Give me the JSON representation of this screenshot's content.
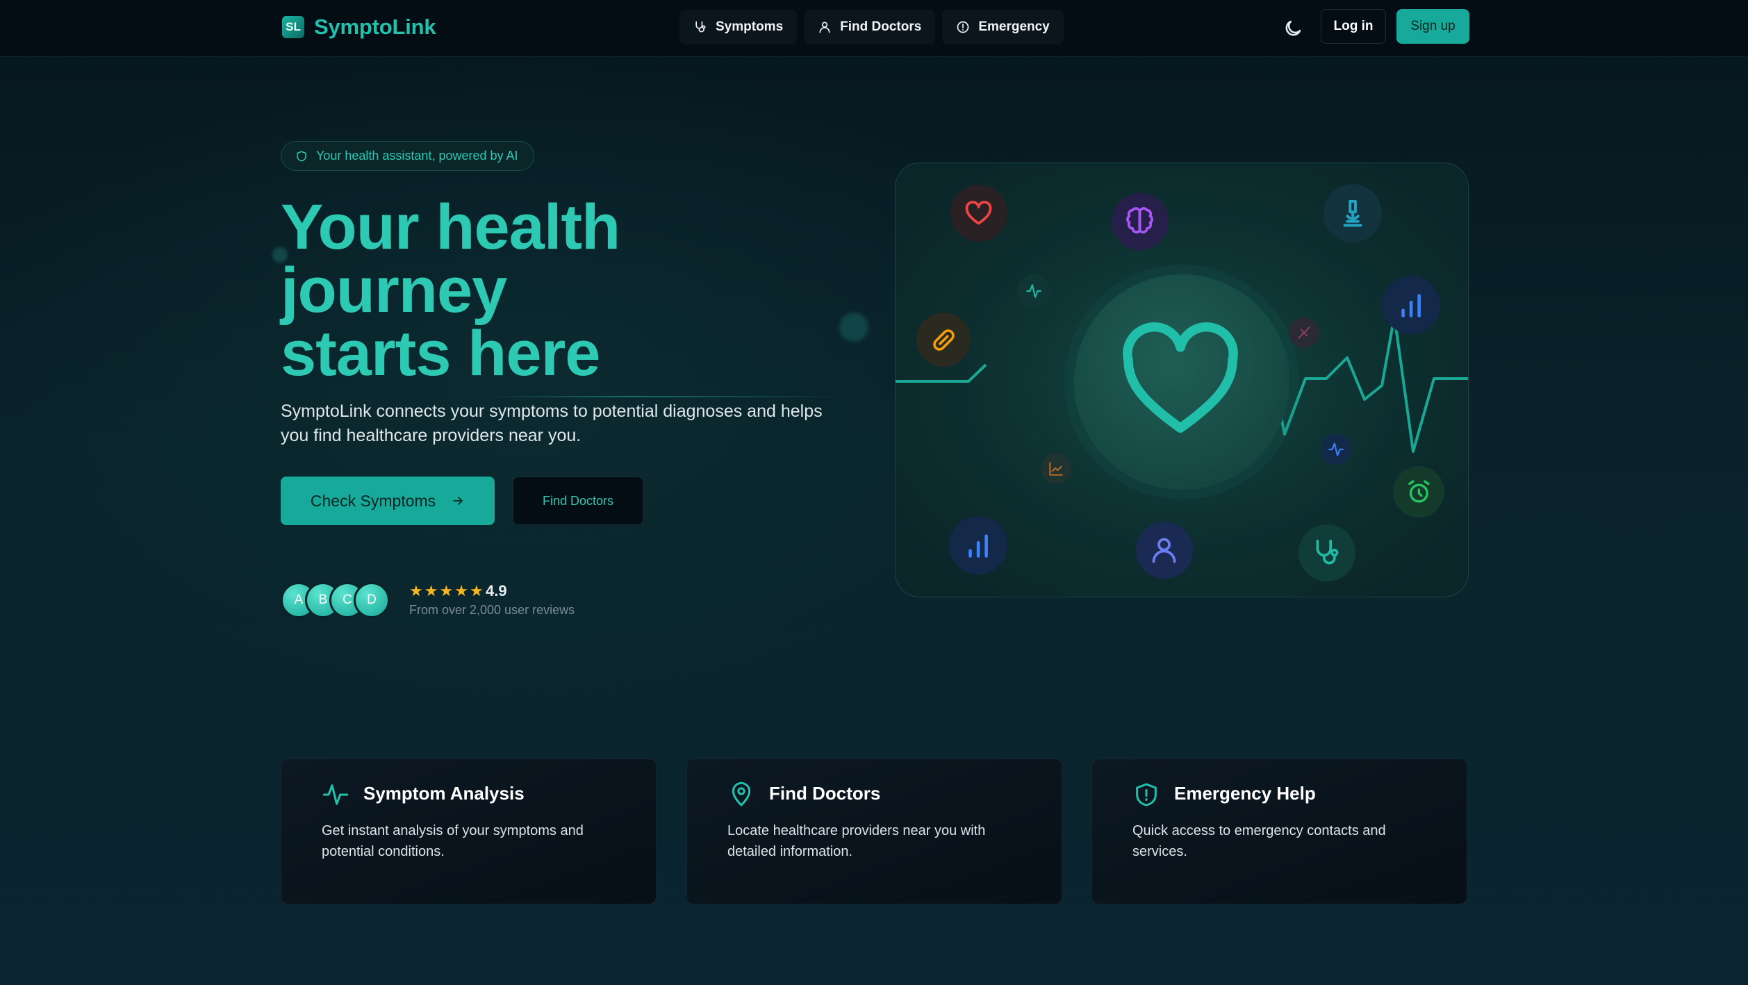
{
  "header": {
    "logo_badge": "SL",
    "logo_text": "SymptoLink",
    "nav": [
      {
        "label": "Symptoms",
        "icon": "stethoscope-icon"
      },
      {
        "label": "Find Doctors",
        "icon": "user-icon"
      },
      {
        "label": "Emergency",
        "icon": "alert-circle-icon"
      }
    ],
    "theme_icon": "moon-icon",
    "login_label": "Log in",
    "signup_label": "Sign up"
  },
  "hero": {
    "badge": "Your health assistant, powered by AI",
    "title_line1": "Your health",
    "title_line2": "journey",
    "title_line3": "starts here",
    "subtitle": "SymptoLink connects your symptoms to potential diagnoses and helps you find healthcare providers near you.",
    "primary_button": "Check Symptoms",
    "secondary_button": "Find Doctors",
    "avatars": [
      "A",
      "B",
      "C",
      "D"
    ],
    "rating": "4.9",
    "stars": 5,
    "reviews_text": "From over 2,000 user reviews"
  },
  "features": [
    {
      "title": "Symptom Analysis",
      "description": "Get instant analysis of your symptoms and potential conditions.",
      "icon": "activity-icon"
    },
    {
      "title": "Find Doctors",
      "description": "Locate healthcare providers near you with detailed information.",
      "icon": "map-pin-icon"
    },
    {
      "title": "Emergency Help",
      "description": "Quick access to emergency contacts and services.",
      "icon": "shield-alert-icon"
    }
  ],
  "colors": {
    "accent": "#17a99a",
    "accent_text": "#2ec9b3",
    "background": "#071a22",
    "header_bg": "#040d14",
    "star": "#f6b620"
  }
}
